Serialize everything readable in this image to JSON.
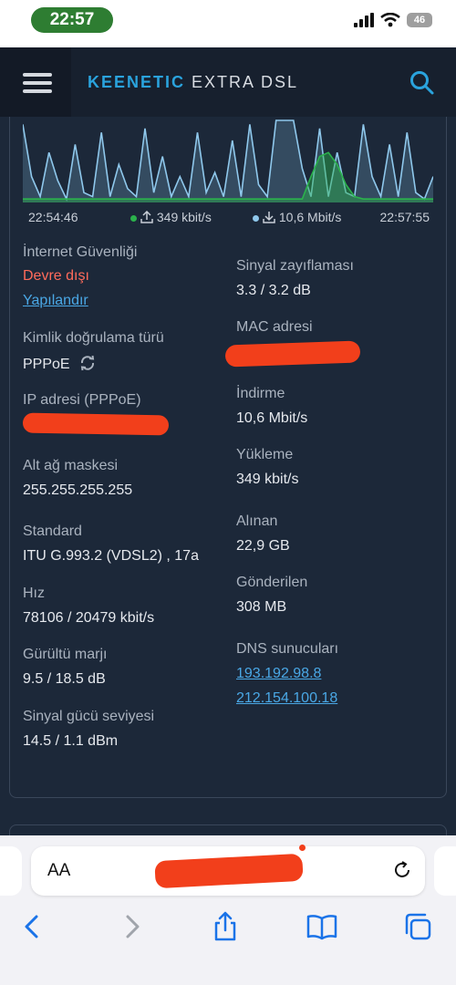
{
  "status": {
    "time": "22:57",
    "battery": "46"
  },
  "header": {
    "brand_bold": "KEENETIC",
    "brand_rest": "EXTRA DSL",
    "menu_icon": "hamburger-menu-icon",
    "search_icon": "search-icon"
  },
  "chart_data": {
    "type": "area",
    "x": [
      "22:54:46",
      "22:57:55"
    ],
    "series": [
      {
        "name": "349 kbit/s",
        "color": "#2bb24c"
      },
      {
        "name": "10,6 Mbit/s",
        "color": "#8fc8ec"
      }
    ]
  },
  "legend": {
    "start": "22:54:46",
    "end": "22:57:55",
    "upload": "349 kbit/s",
    "download": "10,6 Mbit/s"
  },
  "left": {
    "security_label": "İnternet Güvenliği",
    "security_status": "Devre dışı",
    "configure_link": "Yapılandır",
    "auth_label": "Kimlik doğrulama türü",
    "auth_value": "PPPoE",
    "ip_label": "IP adresi (PPPoE)",
    "mask_label": "Alt ağ maskesi",
    "mask_value": "255.255.255.255",
    "standard_label": "Standard",
    "standard_value": "ITU G.993.2 (VDSL2) , 17a",
    "speed_label": "Hız",
    "speed_value": "78106 / 20479 kbit/s",
    "noise_label": "Gürültü marjı",
    "noise_value": "9.5 / 18.5 dB",
    "signal_power_label": "Sinyal gücü seviyesi",
    "signal_power_value": "14.5 / 1.1 dBm"
  },
  "right": {
    "attenuation_label": "Sinyal zayıflaması",
    "attenuation_value": "3.3 / 3.2 dB",
    "mac_label": "MAC adresi",
    "download_label": "İndirme",
    "download_value": "10,6 Mbit/s",
    "upload_label": "Yükleme",
    "upload_value": "349 kbit/s",
    "received_label": "Alınan",
    "received_value": "22,9 GB",
    "sent_label": "Gönderilen",
    "sent_value": "308 MB",
    "dns_label": "DNS sunucuları",
    "dns": [
      "193.192.98.8",
      "212.154.100.18"
    ]
  },
  "browser": {
    "aa_label": "AA"
  }
}
